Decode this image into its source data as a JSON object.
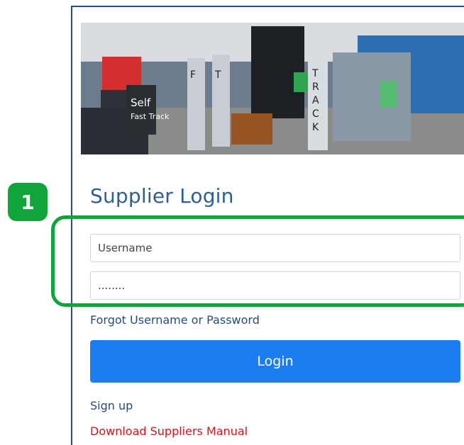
{
  "hero": {
    "image_alt": "Self Fast Track",
    "sign_text": "Self Fast Track",
    "gate_letters": "F T R A C K"
  },
  "login": {
    "title": "Supplier Login",
    "username_placeholder": "Username",
    "password_value": "........",
    "forgot_label": "Forgot Username or Password",
    "login_button": "Login",
    "signup_label": "Sign up",
    "manual_label": "Download Suppliers Manual"
  },
  "annotation": {
    "badge_number": "1"
  },
  "colors": {
    "title": "#2b5f96",
    "button": "#1a7df2",
    "annotation": "#11a43b",
    "manual": "#d3141a"
  }
}
